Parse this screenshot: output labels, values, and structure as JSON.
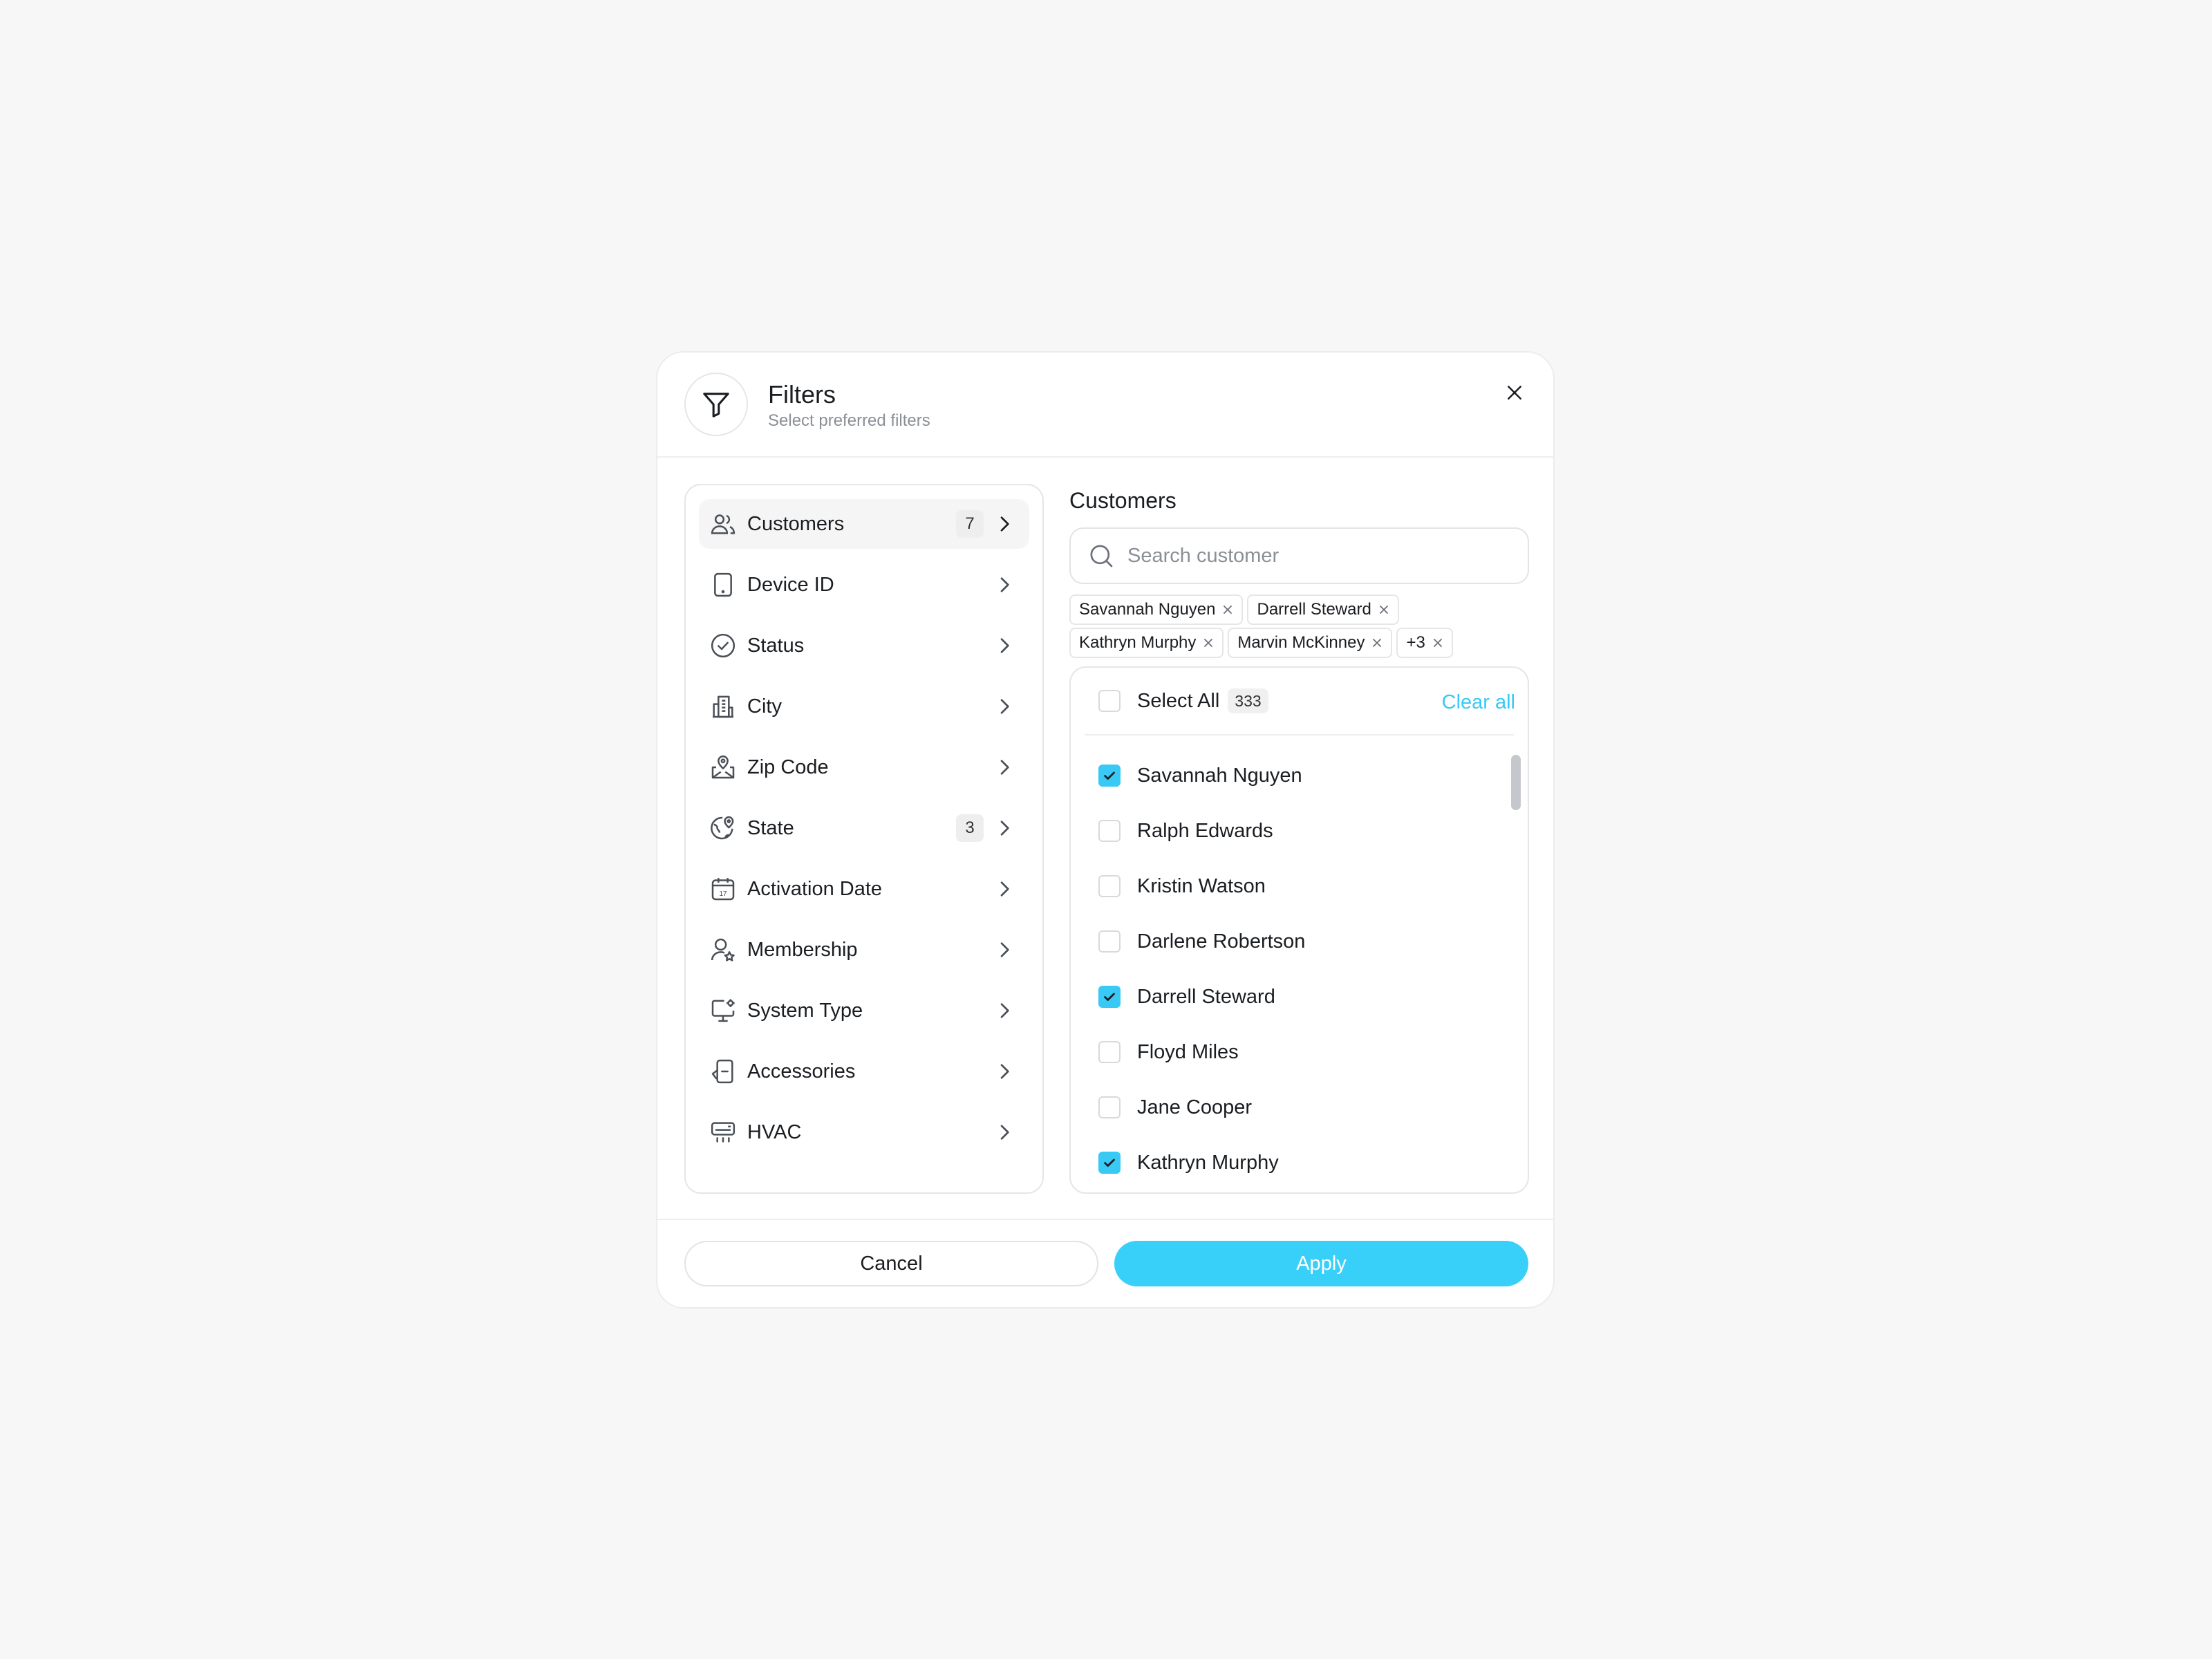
{
  "header": {
    "title": "Filters",
    "subtitle": "Select preferred filters",
    "icon": "filter-icon"
  },
  "categories": [
    {
      "label": "Customers",
      "icon": "users-icon",
      "badge": "7",
      "active": true
    },
    {
      "label": "Device ID",
      "icon": "tablet-icon",
      "badge": null
    },
    {
      "label": "Status",
      "icon": "check-circle-icon",
      "badge": null
    },
    {
      "label": "City",
      "icon": "buildings-icon",
      "badge": null
    },
    {
      "label": "Zip Code",
      "icon": "map-pin-icon",
      "badge": null
    },
    {
      "label": "State",
      "icon": "globe-pin-icon",
      "badge": "3"
    },
    {
      "label": "Activation Date",
      "icon": "calendar-icon",
      "badge": null
    },
    {
      "label": "Membership",
      "icon": "user-star-icon",
      "badge": null
    },
    {
      "label": "System Type",
      "icon": "monitor-gear-icon",
      "badge": null
    },
    {
      "label": "Accessories",
      "icon": "device-icon",
      "badge": null
    },
    {
      "label": "HVAC",
      "icon": "air-conditioner-icon",
      "badge": null
    }
  ],
  "customers": {
    "title": "Customers",
    "search_placeholder": "Search customer",
    "search_value": "",
    "chips_row1": [
      "Savannah Nguyen",
      "Darrell Steward"
    ],
    "chips_row2": [
      "Kathryn Murphy",
      "Marvin McKinney",
      "+3"
    ],
    "select_all_label": "Select All",
    "total_count": "333",
    "clear_all_label": "Clear all",
    "items": [
      {
        "name": "Savannah Nguyen",
        "checked": true
      },
      {
        "name": "Ralph Edwards",
        "checked": false
      },
      {
        "name": "Kristin Watson",
        "checked": false
      },
      {
        "name": "Darlene Robertson",
        "checked": false
      },
      {
        "name": "Darrell Steward",
        "checked": true
      },
      {
        "name": "Floyd Miles",
        "checked": false
      },
      {
        "name": "Jane Cooper",
        "checked": false
      },
      {
        "name": "Kathryn Murphy",
        "checked": true
      }
    ]
  },
  "footer": {
    "cancel_label": "Cancel",
    "apply_label": "Apply"
  },
  "colors": {
    "accent": "#38cff9",
    "background": "#f7f7f7",
    "text": "#1a1d21",
    "muted": "#8a8f96"
  }
}
